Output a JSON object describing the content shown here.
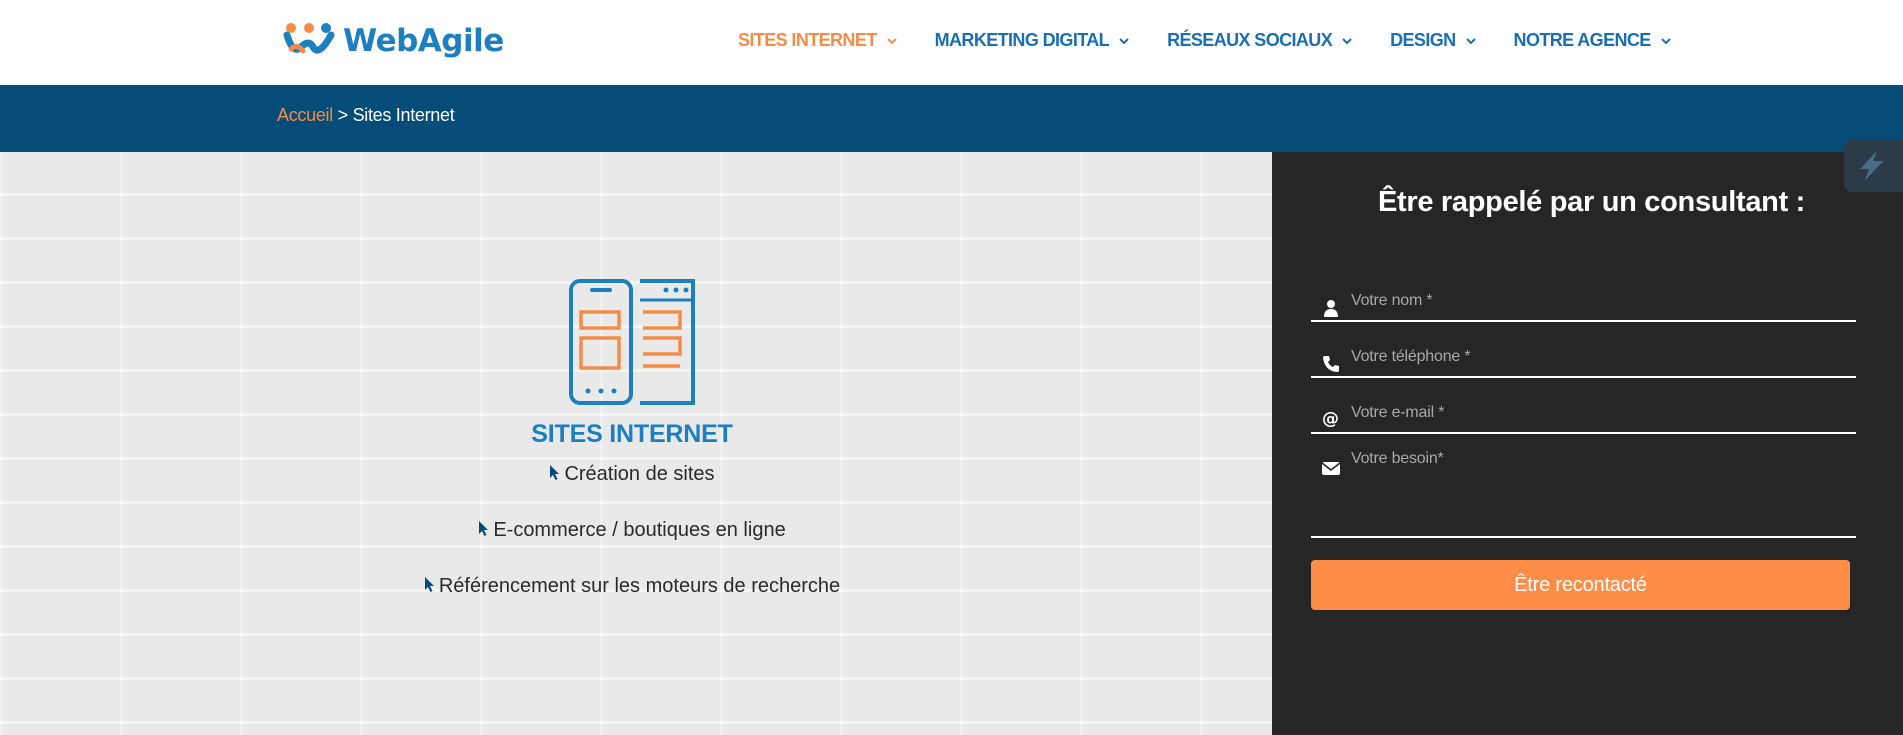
{
  "brand": {
    "logo_text": "WebAgile",
    "colors": {
      "blue": "#1b7fc2",
      "orange": "#f58c46",
      "dark_blue": "#054d78"
    }
  },
  "nav": {
    "items": [
      {
        "label": "SITES INTERNET",
        "active": true
      },
      {
        "label": "MARKETING DIGITAL",
        "active": false
      },
      {
        "label": "RÉSEAUX SOCIAUX",
        "active": false
      },
      {
        "label": "DESIGN",
        "active": false
      },
      {
        "label": "NOTRE AGENCE",
        "active": false
      }
    ],
    "dropdown_icon": "chevron-down-icon"
  },
  "breadcrumb": {
    "home": "Accueil",
    "separator": " > ",
    "current": "Sites Internet"
  },
  "service": {
    "icon": "responsive-devices-icon",
    "title": "SITES INTERNET",
    "items": [
      "Création de sites",
      "E-commerce / boutiques en ligne",
      "Référencement sur les moteurs de recherche"
    ],
    "bullet_icon": "cursor-pointer-icon"
  },
  "callback_form": {
    "title": "Être rappelé par un consultant :",
    "fields": {
      "name": {
        "placeholder": "Votre nom *",
        "icon": "user-icon"
      },
      "phone": {
        "placeholder": "Votre téléphone *",
        "icon": "phone-icon"
      },
      "email": {
        "placeholder": "Votre e-mail *",
        "icon": "at-icon"
      },
      "need": {
        "placeholder": "Votre besoin*",
        "icon": "envelope-icon"
      }
    },
    "submit_label": "Être recontacté",
    "submit_color": "#fd8d47"
  },
  "floating_widget": {
    "icon": "lightning-icon"
  }
}
